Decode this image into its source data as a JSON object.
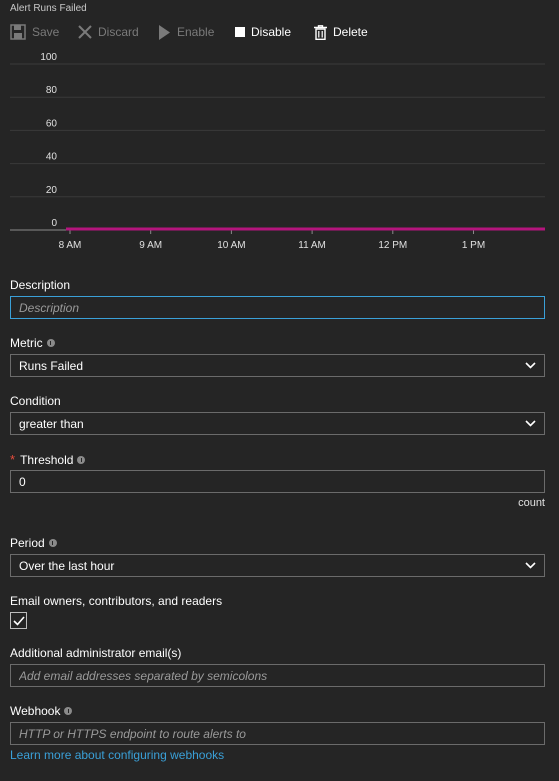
{
  "window": {
    "title": "Alert Runs Failed"
  },
  "toolbar": {
    "save_label": "Save",
    "discard_label": "Discard",
    "enable_label": "Enable",
    "disable_label": "Disable",
    "delete_label": "Delete"
  },
  "chart_data": {
    "type": "line",
    "x_ticks": [
      "8 AM",
      "9 AM",
      "10 AM",
      "11 AM",
      "12 PM",
      "1 PM"
    ],
    "y_ticks": [
      "100",
      "80",
      "60",
      "40",
      "20",
      "0"
    ],
    "ylim": [
      0,
      100
    ],
    "grid": true,
    "series": [
      {
        "values": [
          0,
          0,
          0,
          0,
          0,
          0,
          0
        ],
        "color": "#b4157d"
      }
    ]
  },
  "form": {
    "description": {
      "label": "Description",
      "value": "",
      "placeholder": "Description"
    },
    "metric": {
      "label": "Metric",
      "selected": "Runs Failed"
    },
    "condition": {
      "label": "Condition",
      "selected": "greater than"
    },
    "threshold": {
      "required_mark": "*",
      "label": "Threshold",
      "value": "0",
      "unit": "count"
    },
    "period": {
      "label": "Period",
      "selected": "Over the last hour"
    },
    "email_owners": {
      "label": "Email owners, contributors, and readers",
      "checked": true
    },
    "admin_emails": {
      "label": "Additional administrator email(s)",
      "value": "",
      "placeholder": "Add email addresses separated by semicolons"
    },
    "webhook": {
      "label": "Webhook",
      "value": "",
      "placeholder": "HTTP or HTTPS endpoint to route alerts to"
    },
    "webhook_link": "Learn more about configuring webhooks"
  },
  "colors": {
    "accent": "#3aa0d8",
    "series": "#b4157d",
    "background": "#252525",
    "required": "#e74c3c"
  }
}
